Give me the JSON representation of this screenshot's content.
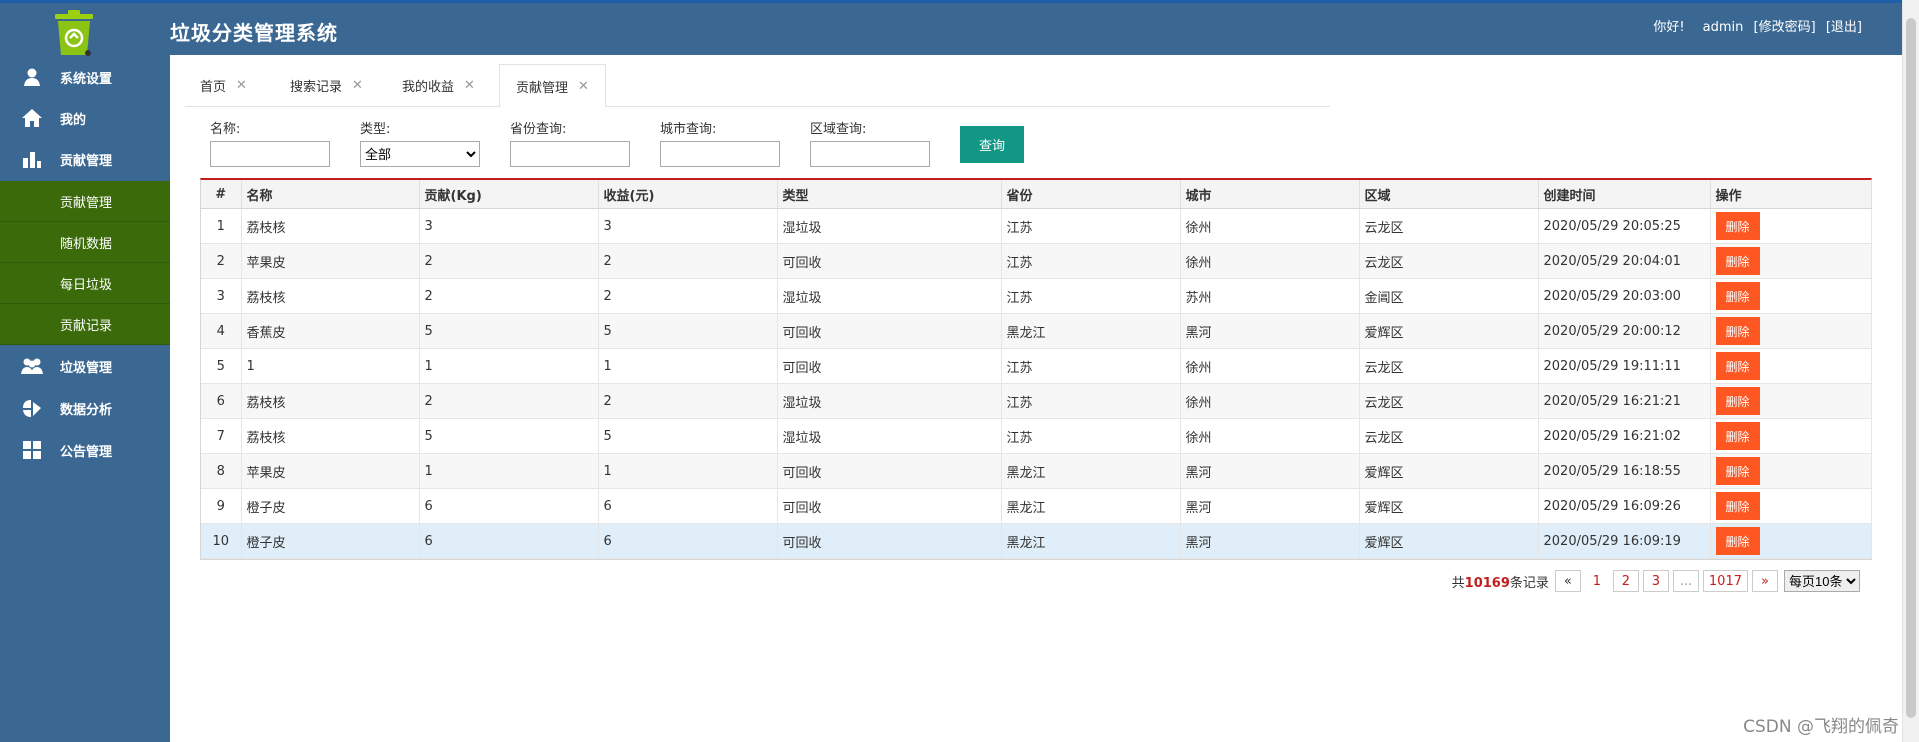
{
  "app": {
    "title": "垃圾分类管理系统"
  },
  "userbar": {
    "greeting": "你好!",
    "username": "admin",
    "change_password": "[修改密码]",
    "logout": "[退出]"
  },
  "sidebar": {
    "items": [
      {
        "label": "系统设置",
        "icon": "user-icon"
      },
      {
        "label": "我的",
        "icon": "home-icon"
      },
      {
        "label": "贡献管理",
        "icon": "bar-chart-icon"
      },
      {
        "label": "垃圾管理",
        "icon": "users-icon"
      },
      {
        "label": "数据分析",
        "icon": "analysis-icon"
      },
      {
        "label": "公告管理",
        "icon": "grid-icon"
      }
    ],
    "subitems": [
      {
        "label": "贡献管理"
      },
      {
        "label": "随机数据"
      },
      {
        "label": "每日垃圾"
      },
      {
        "label": "贡献记录"
      }
    ]
  },
  "tabs": [
    {
      "label": "首页"
    },
    {
      "label": "搜索记录"
    },
    {
      "label": "我的收益"
    },
    {
      "label": "贡献管理"
    }
  ],
  "tab_close": "✕",
  "search": {
    "name_label": "名称:",
    "type_label": "类型:",
    "type_value": "全部",
    "province_label": "省份查询:",
    "city_label": "城市查询:",
    "district_label": "区域查询:",
    "query_button": "查询"
  },
  "table": {
    "headers": [
      "#",
      "名称",
      "贡献(Kg)",
      "收益(元)",
      "类型",
      "省份",
      "城市",
      "区域",
      "创建时间",
      "操作"
    ],
    "delete_label": "删除",
    "rows": [
      [
        "1",
        "荔枝核",
        "3",
        "3",
        "湿垃圾",
        "江苏",
        "徐州",
        "云龙区",
        "2020/05/29 20:05:25"
      ],
      [
        "2",
        "苹果皮",
        "2",
        "2",
        "可回收",
        "江苏",
        "徐州",
        "云龙区",
        "2020/05/29 20:04:01"
      ],
      [
        "3",
        "荔枝核",
        "2",
        "2",
        "湿垃圾",
        "江苏",
        "苏州",
        "金阊区",
        "2020/05/29 20:03:00"
      ],
      [
        "4",
        "香蕉皮",
        "5",
        "5",
        "可回收",
        "黑龙江",
        "黑河",
        "爱辉区",
        "2020/05/29 20:00:12"
      ],
      [
        "5",
        "1",
        "1",
        "1",
        "可回收",
        "江苏",
        "徐州",
        "云龙区",
        "2020/05/29 19:11:11"
      ],
      [
        "6",
        "荔枝核",
        "2",
        "2",
        "湿垃圾",
        "江苏",
        "徐州",
        "云龙区",
        "2020/05/29 16:21:21"
      ],
      [
        "7",
        "荔枝核",
        "5",
        "5",
        "湿垃圾",
        "江苏",
        "徐州",
        "云龙区",
        "2020/05/29 16:21:02"
      ],
      [
        "8",
        "苹果皮",
        "1",
        "1",
        "可回收",
        "黑龙江",
        "黑河",
        "爱辉区",
        "2020/05/29 16:18:55"
      ],
      [
        "9",
        "橙子皮",
        "6",
        "6",
        "可回收",
        "黑龙江",
        "黑河",
        "爱辉区",
        "2020/05/29 16:09:26"
      ],
      [
        "10",
        "橙子皮",
        "6",
        "6",
        "可回收",
        "黑龙江",
        "黑河",
        "爱辉区",
        "2020/05/29 16:09:19"
      ]
    ]
  },
  "pager": {
    "total_prefix": "共",
    "total_count": "10169",
    "total_suffix": "条记录",
    "prev": "«",
    "pages": [
      "1",
      "2",
      "3",
      "...",
      "1017"
    ],
    "next": "»",
    "page_size": "每页10条"
  },
  "watermark": "CSDN @飞翔的佩奇",
  "colors": {
    "header": "#3b6893",
    "submenu": "#3a6a09",
    "query_button": "#129785",
    "delete_button": "#ff5722",
    "accent": "#c21e1e"
  }
}
